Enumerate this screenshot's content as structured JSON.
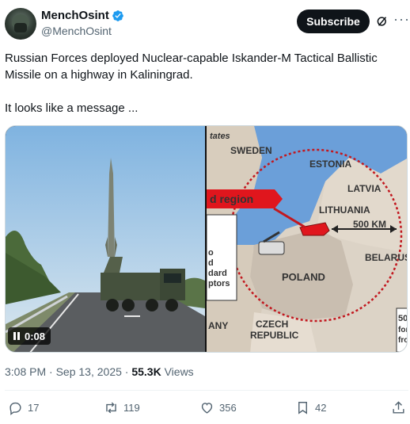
{
  "author": {
    "display_name": "MenchOsint",
    "handle": "@MenchOsint"
  },
  "header": {
    "subscribe_label": "Subscribe",
    "more_label": "···"
  },
  "post": {
    "paragraphs": [
      "Russian Forces deployed Nuclear-capable Iskander-M Tactical Ballistic Missile on a highway in Kaliningrad.",
      "It looks like a message ..."
    ]
  },
  "media": {
    "video_time": "0:08",
    "map_labels": {
      "states_fragment": "tates",
      "sweden": "SWEDEN",
      "estonia": "ESTONIA",
      "latvia": "LATVIA",
      "lithuania": "LITHUANIA",
      "range": "500 KM",
      "belarus": "BELARUS",
      "poland": "POLAND",
      "czech_1": "CZECH",
      "czech_2": "REPUBLIC",
      "any_fragment": "ANY",
      "region_fragment": "d region",
      "box_lines": [
        "o",
        "d",
        "dard",
        "ptors"
      ],
      "right_box": [
        "50",
        "for",
        "fro"
      ]
    }
  },
  "meta": {
    "time": "3:08 PM",
    "dot": "·",
    "date": "Sep 13, 2025",
    "views_count": "55.3K",
    "views_label": "Views"
  },
  "actions": {
    "replies": "17",
    "reposts": "119",
    "likes": "356",
    "bookmarks": "42"
  },
  "colors": {
    "verified": "#1d9bf0",
    "accent_red": "#e0161d",
    "sea": "#6b9fd9",
    "land": "#dcd3c6"
  }
}
